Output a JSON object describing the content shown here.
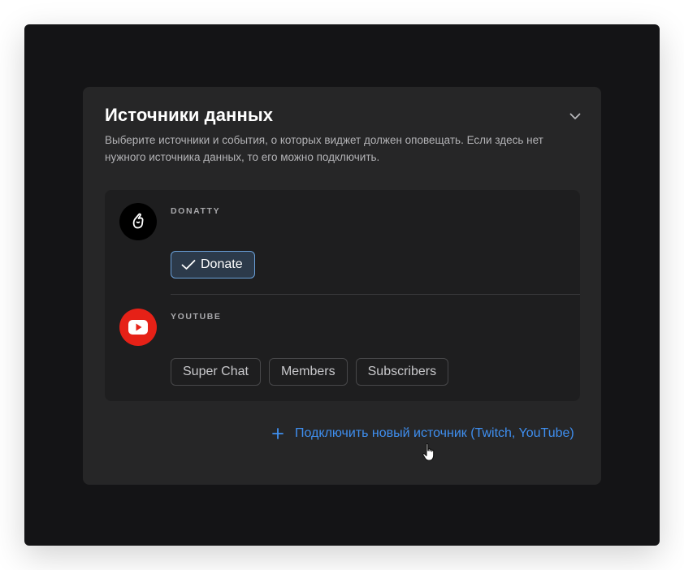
{
  "panel": {
    "title": "Источники данных",
    "description": "Выберите источники и события, о которых виджет должен оповещать. Если здесь нет нужного источника данных, то его можно подключить."
  },
  "sources": [
    {
      "name": "DONATTY",
      "logo_icon": "donatty-hand-icon",
      "events": [
        {
          "label": "Donate",
          "selected": true
        }
      ]
    },
    {
      "name": "YOUTUBE",
      "logo_icon": "youtube-play-icon",
      "events": [
        {
          "label": "Super Chat",
          "selected": false
        },
        {
          "label": "Members",
          "selected": false
        },
        {
          "label": "Subscribers",
          "selected": false
        }
      ]
    }
  ],
  "connect": {
    "label": "Подключить новый источник (Twitch, YouTube)"
  },
  "colors": {
    "accent": "#3f8ff0",
    "youtube_red": "#e62117",
    "selected_border": "#6aa0d8"
  }
}
